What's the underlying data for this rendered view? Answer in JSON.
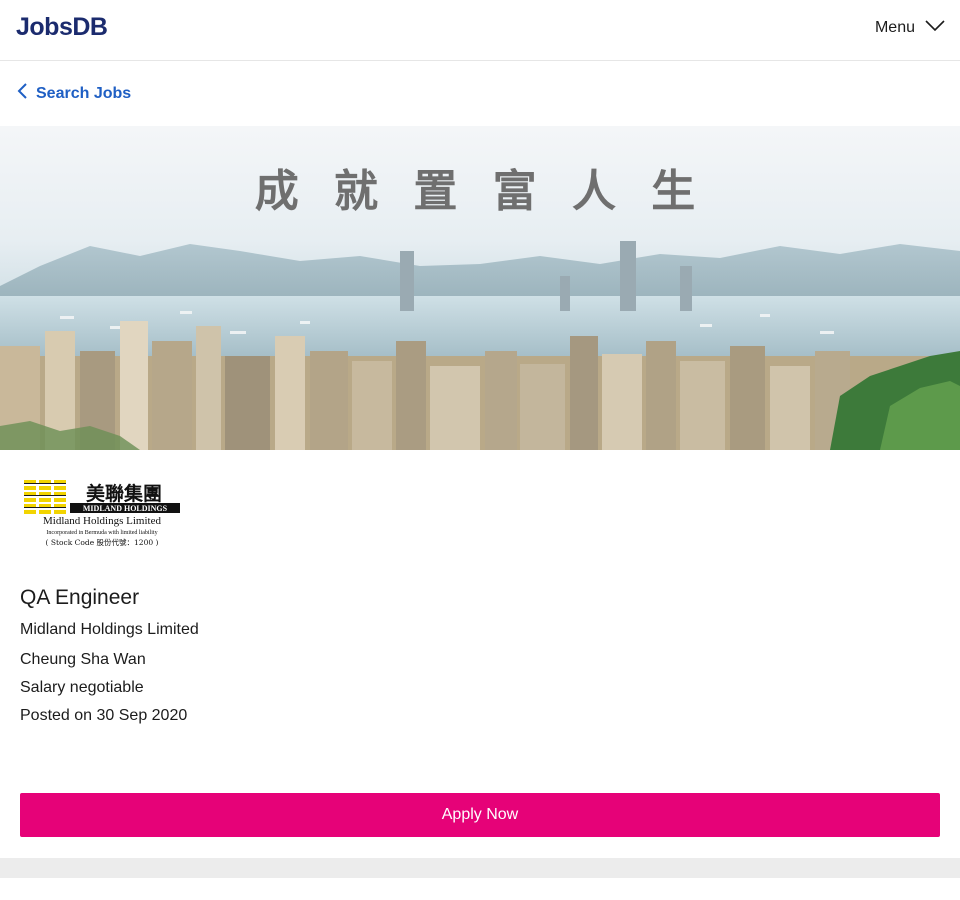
{
  "header": {
    "logo_text": "JobsDB",
    "menu_label": "Menu",
    "menu_icon": "chevron-down-icon"
  },
  "nav": {
    "back_label": "Search Jobs",
    "back_icon": "chevron-left-icon"
  },
  "banner": {
    "slogan": "成 就 置 富 人 生"
  },
  "company_logo": {
    "chinese": "美聯集團",
    "line1": "MIDLAND HOLDINGS",
    "line2": "Midland Holdings Limited",
    "line3": "Incorporated in Bermuda with limited liability",
    "line4": "( Stock Code 股份代號：1200 )"
  },
  "job": {
    "title": "QA Engineer",
    "company": "Midland Holdings Limited",
    "location": "Cheung Sha Wan",
    "salary": "Salary negotiable",
    "posted": "Posted on 30 Sep 2020"
  },
  "actions": {
    "apply_label": "Apply Now"
  },
  "colors": {
    "brand": "#1b2b6e",
    "link": "#1f5fc4",
    "apply": "#e60278"
  }
}
